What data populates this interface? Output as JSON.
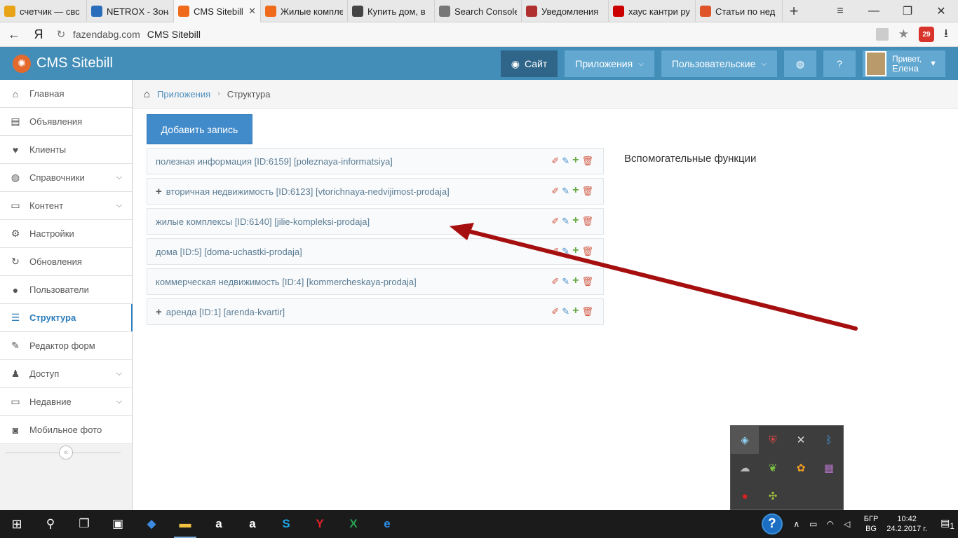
{
  "browser": {
    "tabs": [
      {
        "label": "счетчик — свс",
        "icon": "bar-chart-icon",
        "color": "#e8a317",
        "active": false
      },
      {
        "label": "NETROX - Зона",
        "icon": "globe-icon",
        "color": "#2a6ebb",
        "active": false
      },
      {
        "label": "CMS Sitebill",
        "icon": "sitebill-icon",
        "color": "#f06a1b",
        "active": true,
        "close": "✕"
      },
      {
        "label": "Жилые компле",
        "icon": "sitebill-icon",
        "color": "#f06a1b",
        "active": false
      },
      {
        "label": "Купить дом, в",
        "icon": "house-icon",
        "color": "#444444",
        "active": false
      },
      {
        "label": "Search Console",
        "icon": "search-console-icon",
        "color": "#777777",
        "active": false
      },
      {
        "label": "Уведомления",
        "icon": "code-icon",
        "color": "#b03030",
        "active": false
      },
      {
        "label": "хаус кантри ру",
        "icon": "yandex-icon",
        "color": "#cc0000",
        "active": false
      },
      {
        "label": "Статьи по нед",
        "icon": "habr-icon",
        "color": "#e0542a",
        "active": false
      }
    ],
    "new_tab": "+",
    "domain": "fazendabg.com",
    "page_title": "CMS Sitebill",
    "yandex_logo": "Я",
    "ext_badge": "29"
  },
  "header": {
    "logo_text": "CMS Sitebill",
    "site_label": "Сайт",
    "apps_label": "Приложения",
    "custom_label": "Пользовательские",
    "greeting": "Привет,",
    "user_name": "Елена"
  },
  "sidebar": {
    "items": [
      {
        "label": "Главная",
        "icon": "home-icon",
        "glyph": "⌂",
        "chevron": false,
        "active": false
      },
      {
        "label": "Объявления",
        "icon": "book-icon",
        "glyph": "▤",
        "chevron": false,
        "active": false
      },
      {
        "label": "Клиенты",
        "icon": "heart-icon",
        "glyph": "♥",
        "chevron": false,
        "active": false
      },
      {
        "label": "Справочники",
        "icon": "globe-icon",
        "glyph": "◍",
        "chevron": true,
        "active": false
      },
      {
        "label": "Контент",
        "icon": "coffee-icon",
        "glyph": "▭",
        "chevron": true,
        "active": false
      },
      {
        "label": "Настройки",
        "icon": "gear-icon",
        "glyph": "⚙",
        "chevron": false,
        "active": false
      },
      {
        "label": "Обновления",
        "icon": "refresh-icon",
        "glyph": "↻",
        "chevron": false,
        "active": false
      },
      {
        "label": "Пользователи",
        "icon": "user-icon",
        "glyph": "●",
        "chevron": false,
        "active": false
      },
      {
        "label": "Структура",
        "icon": "list-icon",
        "glyph": "☰",
        "chevron": false,
        "active": true
      },
      {
        "label": "Редактор форм",
        "icon": "edit-icon",
        "glyph": "✎",
        "chevron": false,
        "active": false
      },
      {
        "label": "Доступ",
        "icon": "users-icon",
        "glyph": "♟",
        "chevron": true,
        "active": false
      },
      {
        "label": "Недавние",
        "icon": "desktop-icon",
        "glyph": "▭",
        "chevron": true,
        "active": false
      },
      {
        "label": "Мобильное фото",
        "icon": "camera-icon",
        "glyph": "◙",
        "chevron": false,
        "active": false
      }
    ]
  },
  "breadcrumb": {
    "link": "Приложения",
    "current": "Структура"
  },
  "main": {
    "add_button": "Добавить запись",
    "helper_title": "Вспомогательные функции",
    "rows": [
      {
        "label": "полезная информация [ID:6159] [poleznaya-informatsiya]",
        "expandable": false
      },
      {
        "label": "вторичная недвижимость [ID:6123] [vtorichnaya-nedvijimost-prodaja]",
        "expandable": true
      },
      {
        "label": "жилые комплексы [ID:6140] [jilie-kompleksi-prodaja]",
        "expandable": false
      },
      {
        "label": "дома [ID:5] [doma-uchastki-prodaja]",
        "expandable": false
      },
      {
        "label": "коммерческая недвижимость [ID:4] [kommercheskaya-prodaja]",
        "expandable": false
      },
      {
        "label": "аренда [ID:1] [arenda-kvartir]",
        "expandable": true
      }
    ]
  },
  "annotation": {
    "arrow_color": "#a50f0f"
  },
  "taskbar": {
    "lang_line1": "БГР",
    "lang_line2": "BG",
    "time": "10:42",
    "date": "24.2.2017 г.",
    "notif_count": "1"
  }
}
